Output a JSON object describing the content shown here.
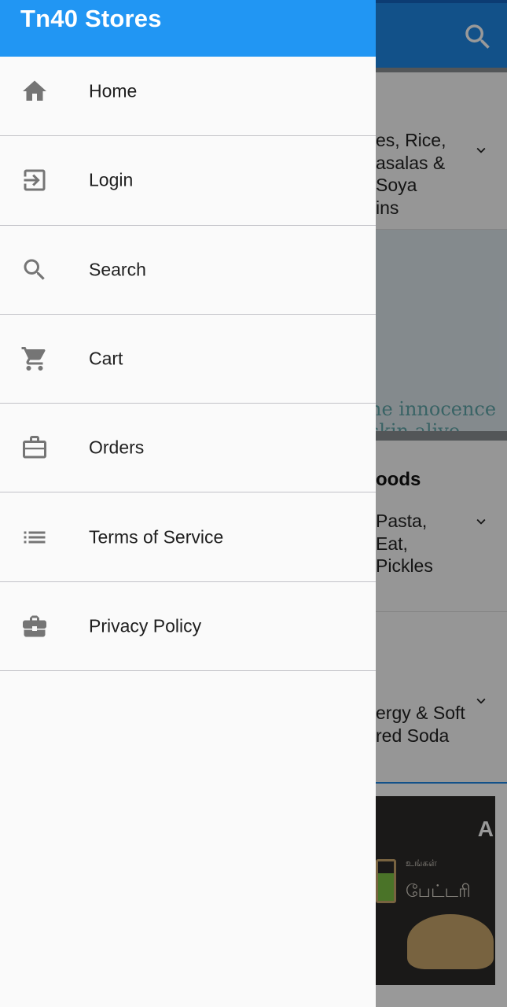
{
  "drawer": {
    "title": "Tn40 Stores",
    "items": [
      {
        "label": "Home",
        "icon": "home-icon"
      },
      {
        "label": "Login",
        "icon": "login-icon"
      },
      {
        "label": "Search",
        "icon": "search-icon"
      },
      {
        "label": "Cart",
        "icon": "cart-icon"
      },
      {
        "label": "Orders",
        "icon": "briefcase-icon"
      },
      {
        "label": "Terms of Service",
        "icon": "list-icon"
      },
      {
        "label": "Privacy Policy",
        "icon": "briefcase-icon"
      }
    ]
  },
  "background": {
    "card1_text": "es, Rice,\nasalas &\n Soya\nins",
    "banner_text": "he innocence\n  skin alive.",
    "card2_title": "oods",
    "card2_text": " Pasta,\n Eat,\nPickles",
    "card3_text": "ergy & Soft\nred Soda",
    "ad_small_text": "உங்கள்",
    "ad_text": "பேட்டரி",
    "ad_logo": "A"
  },
  "colors": {
    "drawer_header": "#2196f3",
    "app_bar": "#1e88e5",
    "drawer_bg": "#fafafa",
    "icon_gray": "#757575",
    "divider": "#c3c3c8"
  }
}
